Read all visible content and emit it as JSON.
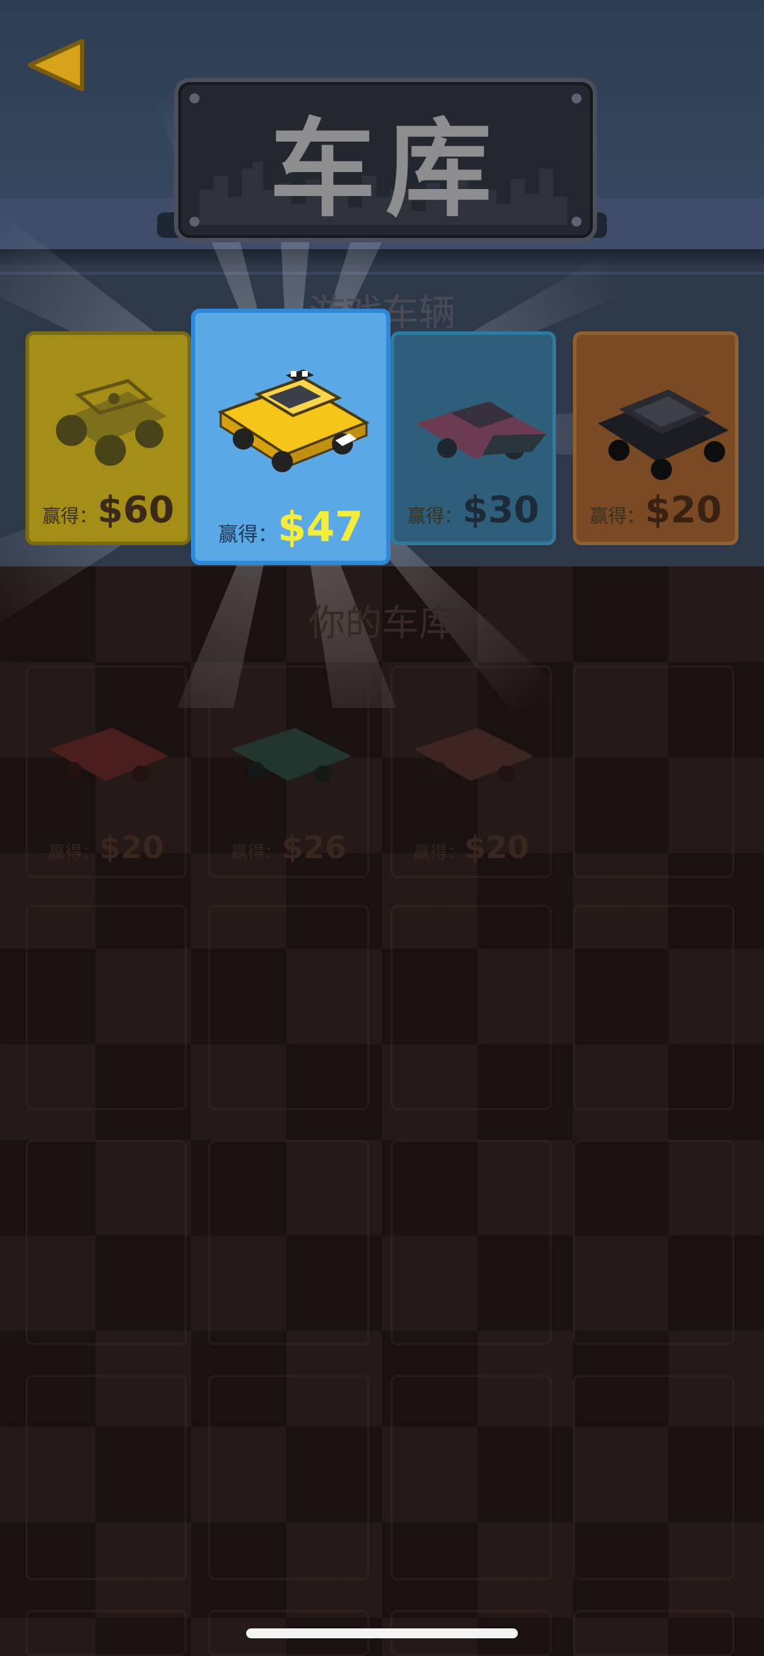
{
  "header": {
    "title": "车库"
  },
  "sections": {
    "vehicles_title": "游戏车辆",
    "garage_title": "你的车库"
  },
  "vehicles": [
    {
      "prefix": "赢得：",
      "price": "$60",
      "color": "#a58e17"
    },
    {
      "prefix": "赢得：",
      "price": "$47",
      "color": "#5aa8e6"
    },
    {
      "prefix": "赢得：",
      "price": "$30",
      "color": "#2f5e7a"
    },
    {
      "prefix": "赢得：",
      "price": "$20",
      "color": "#7a4a25"
    }
  ],
  "garage": [
    {
      "prefix": "赢得：",
      "price": "$20"
    },
    {
      "prefix": "赢得：",
      "price": "$26"
    },
    {
      "prefix": "赢得：",
      "price": "$20"
    }
  ],
  "icons": {
    "back": "back-arrow-icon"
  },
  "colors": {
    "selected_price": "#f4ee3a",
    "price_dark": "#3a2a1a",
    "accent_blue": "#2f88d8"
  }
}
